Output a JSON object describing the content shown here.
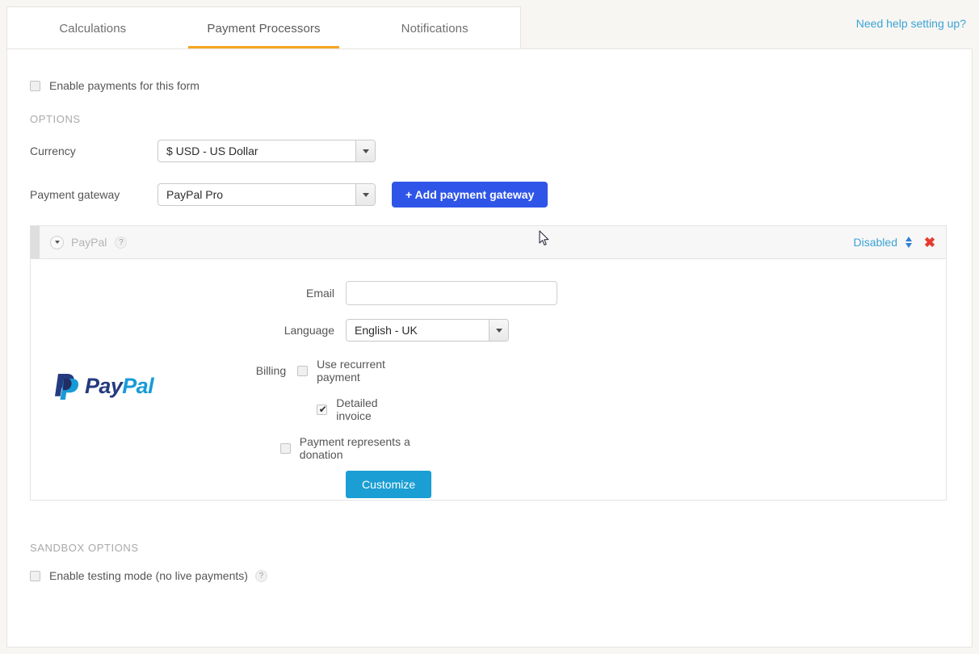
{
  "tabs": [
    {
      "label": "Calculations",
      "active": false
    },
    {
      "label": "Payment Processors",
      "active": true
    },
    {
      "label": "Notifications",
      "active": false
    }
  ],
  "header": {
    "help_link": "Need help setting up?",
    "accent_color": "#f5a623",
    "link_color": "#3ba3d6"
  },
  "enable_payments": {
    "label": "Enable payments for this form",
    "checked": false
  },
  "options": {
    "title": "OPTIONS",
    "currency": {
      "label": "Currency",
      "value": "$ USD - US Dollar"
    },
    "gateway": {
      "label": "Payment gateway",
      "value": "PayPal Pro"
    },
    "add_button": "+ Add payment gateway",
    "add_button_color": "#2f55e8"
  },
  "gateway_card": {
    "name": "PayPal",
    "help_icon": "?",
    "status": "Disabled",
    "status_color": "#3ba3d6",
    "sort_icon": "sort-updown-icon",
    "close_icon": "✖",
    "logo": {
      "pay": "Pay",
      "pal": "Pal",
      "dark_color": "#253b80",
      "light_color": "#179bd7"
    },
    "fields": {
      "email": {
        "label": "Email",
        "value": "",
        "placeholder": ""
      },
      "language": {
        "label": "Language",
        "value": "English - UK"
      },
      "billing": {
        "label": "Billing",
        "recurrent": {
          "label": "Use recurrent payment",
          "checked": false
        },
        "detailed_invoice": {
          "label": "Detailed invoice",
          "checked": true
        },
        "donation": {
          "label": "Payment represents a donation",
          "checked": false
        }
      },
      "customize_button": "Customize",
      "customize_color": "#1a9ed4"
    }
  },
  "sandbox": {
    "title": "SANDBOX OPTIONS",
    "testing_mode": {
      "label": "Enable testing mode (no live payments)",
      "checked": false,
      "help_icon": "?"
    }
  }
}
